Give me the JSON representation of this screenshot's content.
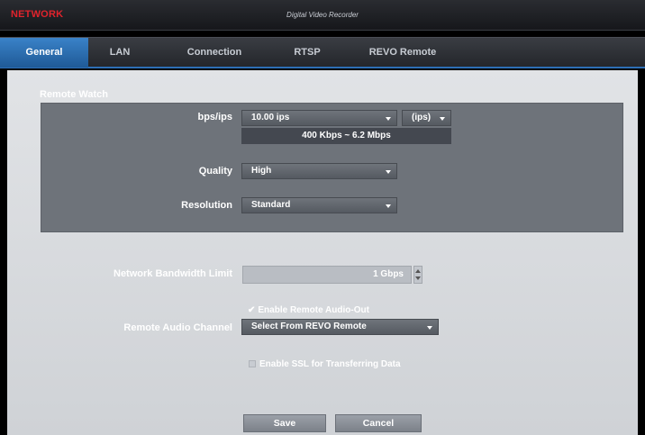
{
  "header": {
    "app_title": "NETWORK",
    "center_title": "Digital Video Recorder"
  },
  "tabs": [
    {
      "label": "General",
      "active": true
    },
    {
      "label": "LAN",
      "active": false
    },
    {
      "label": "Connection",
      "active": false
    },
    {
      "label": "RTSP",
      "active": false
    },
    {
      "label": "REVO Remote",
      "active": false
    }
  ],
  "remote_watch": {
    "section_title": "Remote Watch",
    "bps_label": "bps/ips",
    "bps_value": "10.00 ips",
    "unit_value": "(ips)",
    "rate_range": "400 Kbps ~ 6.2 Mbps",
    "quality_label": "Quality",
    "quality_value": "High",
    "resolution_label": "Resolution",
    "resolution_value": "Standard"
  },
  "bandwidth": {
    "label": "Network Bandwidth Limit",
    "value": "1 Gbps"
  },
  "audio": {
    "enable_label": "Enable Remote Audio-Out",
    "enabled": true,
    "channel_label": "Remote Audio Channel",
    "channel_value": "Select From REVO Remote"
  },
  "ssl": {
    "label": "Enable SSL for Transferring Data",
    "enabled": false
  },
  "buttons": {
    "save": "Save",
    "cancel": "Cancel"
  }
}
